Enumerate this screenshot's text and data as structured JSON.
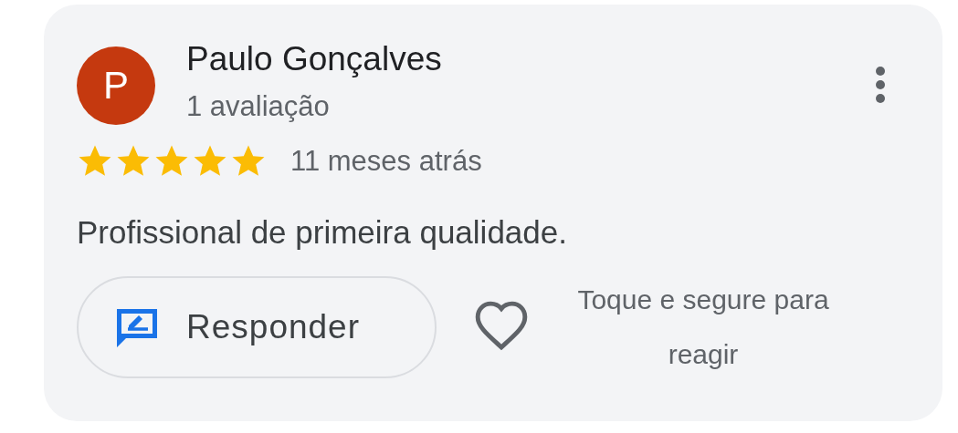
{
  "review": {
    "avatar_letter": "P",
    "author": "Paulo Gonçalves",
    "review_count": "1 avaliação",
    "stars": 5,
    "time": "11 meses atrás",
    "text": "Profissional de primeira qualidade.",
    "reply_button": {
      "label": "Responder"
    },
    "reaction_hint": "Toque e segure para reagir"
  }
}
